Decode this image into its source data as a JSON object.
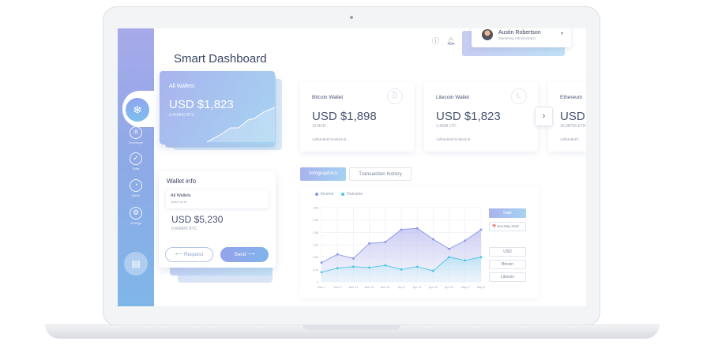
{
  "dashboard": {
    "title": "Smart Dashboard"
  },
  "header": {
    "info_icon": "info-icon",
    "notification_icon": "bell-icon"
  },
  "profile": {
    "name": "Austin Robertson",
    "role": "Marketing Administrator",
    "chevron": "▾"
  },
  "sidebar": {
    "active_icon": "❄",
    "items": [
      {
        "label": "Exchange",
        "icon": "atom-icon",
        "glyph": "⚛"
      },
      {
        "label": "Stats",
        "icon": "check-icon",
        "glyph": "✓"
      },
      {
        "label": "Wallet",
        "icon": "gauge-icon",
        "glyph": "◔"
      },
      {
        "label": "Settings",
        "icon": "settings-icon",
        "glyph": "⚙"
      }
    ],
    "bottom_icon": "▤"
  },
  "all_wallets": {
    "label": "All Wallets",
    "amount": "USD $1,823",
    "sub": "0,456842 BTC"
  },
  "wallets": [
    {
      "name": "Bitcoin Wallet",
      "amount": "USD $1,898",
      "sub": "13 BCH",
      "address": "14f84e5687ec5834c8...",
      "coin": "₿"
    },
    {
      "name": "Litecoin Wallet",
      "amount": "USD $1,823",
      "sub": "1,4568 LTC",
      "address": "14f84e5687ec5834c8...",
      "coin": "Ł"
    },
    {
      "name": "Ethereum",
      "amount": "USD",
      "sub": "16,98756 ETH",
      "address": "14f84e5687..."
    }
  ],
  "next_arrow": "›",
  "wallet_info": {
    "title": "Wallet info",
    "row_title": "All Wallets",
    "row_sub": "Wallet 5a 8c",
    "amount": "USD $5,230",
    "sub": "0,456842 BTC",
    "request": "⟵  Request",
    "send": "Send  ⟶"
  },
  "tabs": {
    "infographics": "Infographics",
    "history": "Transaction history"
  },
  "controls": {
    "date_label": "Date",
    "date_value": "📅  Nov-May 2018",
    "currencies": [
      "USD",
      "Bitcoin",
      "Litecoin"
    ]
  },
  "colors": {
    "income": "#8a95e8",
    "outcome": "#4cc4e6"
  },
  "chart_data": {
    "type": "area",
    "x": [
      "Nov 1",
      "Nov 5",
      "Nov 11",
      "Nov 15",
      "Nov 22",
      "Apr 8",
      "Apr 11",
      "Apr 15",
      "Apr 22",
      "May 3",
      "May 9"
    ],
    "yticks": [
      "2,5k",
      "2,0k",
      "1,5k",
      "1,0k",
      "0,5k",
      "0,1k",
      "0"
    ],
    "ylim": [
      0,
      2.7
    ],
    "series": [
      {
        "name": "Income",
        "values": [
          0.7,
          1.0,
          0.85,
          1.4,
          1.45,
          1.9,
          1.95,
          1.55,
          1.2,
          1.5,
          1.9
        ]
      },
      {
        "name": "Outcome",
        "values": [
          0.35,
          0.5,
          0.55,
          0.52,
          0.6,
          0.45,
          0.55,
          0.4,
          0.9,
          0.78,
          0.9
        ]
      }
    ]
  }
}
